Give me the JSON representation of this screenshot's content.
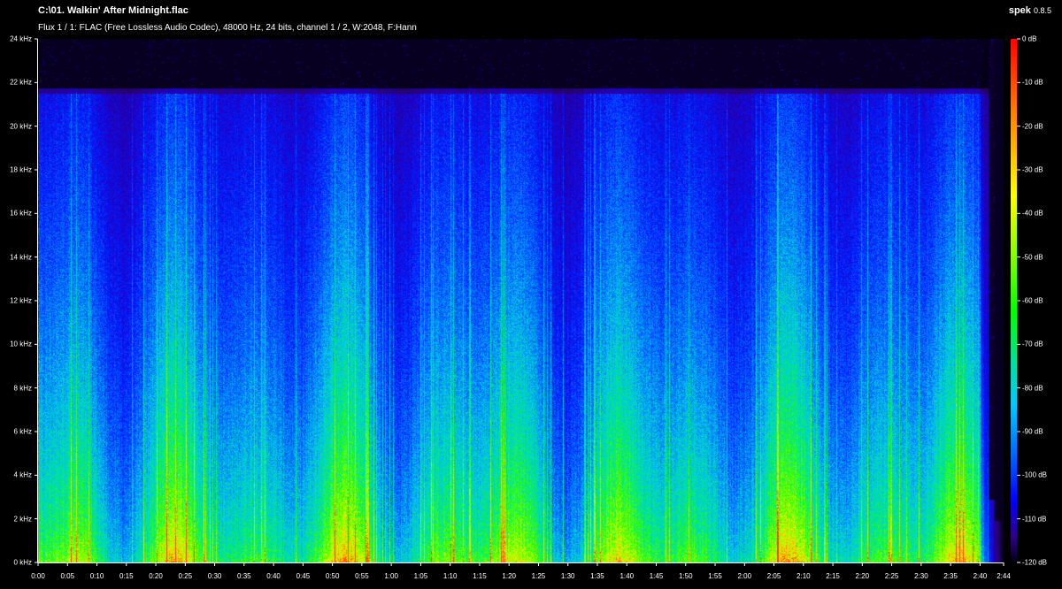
{
  "header": {
    "file_title": "C:\\01. Walkin' After Midnight.flac",
    "stream_info": "Flux 1 / 1: FLAC (Free Lossless Audio Codec), 48000 Hz, 24 bits, channel 1 / 2, W:2048, F:Hann",
    "app_name": "spek",
    "app_version": "0.8.5"
  },
  "frequency_axis": {
    "labels": [
      "24 kHz",
      "22 kHz",
      "20 kHz",
      "18 kHz",
      "16 kHz",
      "14 kHz",
      "12 kHz",
      "10 kHz",
      "8 kHz",
      "6 kHz",
      "4 kHz",
      "2 kHz",
      "0 kHz"
    ],
    "max_khz": 24
  },
  "time_axis": {
    "labels": [
      "0:00",
      "0:05",
      "0:10",
      "0:15",
      "0:20",
      "0:25",
      "0:30",
      "0:35",
      "0:40",
      "0:45",
      "0:50",
      "0:55",
      "1:00",
      "1:05",
      "1:10",
      "1:15",
      "1:20",
      "1:25",
      "1:30",
      "1:35",
      "1:40",
      "1:45",
      "1:50",
      "1:55",
      "2:00",
      "2:05",
      "2:10",
      "2:15",
      "2:20",
      "2:25",
      "2:30",
      "2:35",
      "2:40",
      "2:44"
    ],
    "duration_s": 164
  },
  "colorbar": {
    "labels": [
      "0 dB",
      "-10 dB",
      "-20 dB",
      "-30 dB",
      "-40 dB",
      "-50 dB",
      "-60 dB",
      "-70 dB",
      "-80 dB",
      "-90 dB",
      "-100 dB",
      "-110 dB",
      "-120 dB"
    ],
    "colors": [
      "#ff0000",
      "#ff7f00",
      "#ffff00",
      "#7fff00",
      "#00ff00",
      "#00e0a0",
      "#00c8ff",
      "#0060ff",
      "#0000ff",
      "#30008a",
      "#000010"
    ]
  }
}
